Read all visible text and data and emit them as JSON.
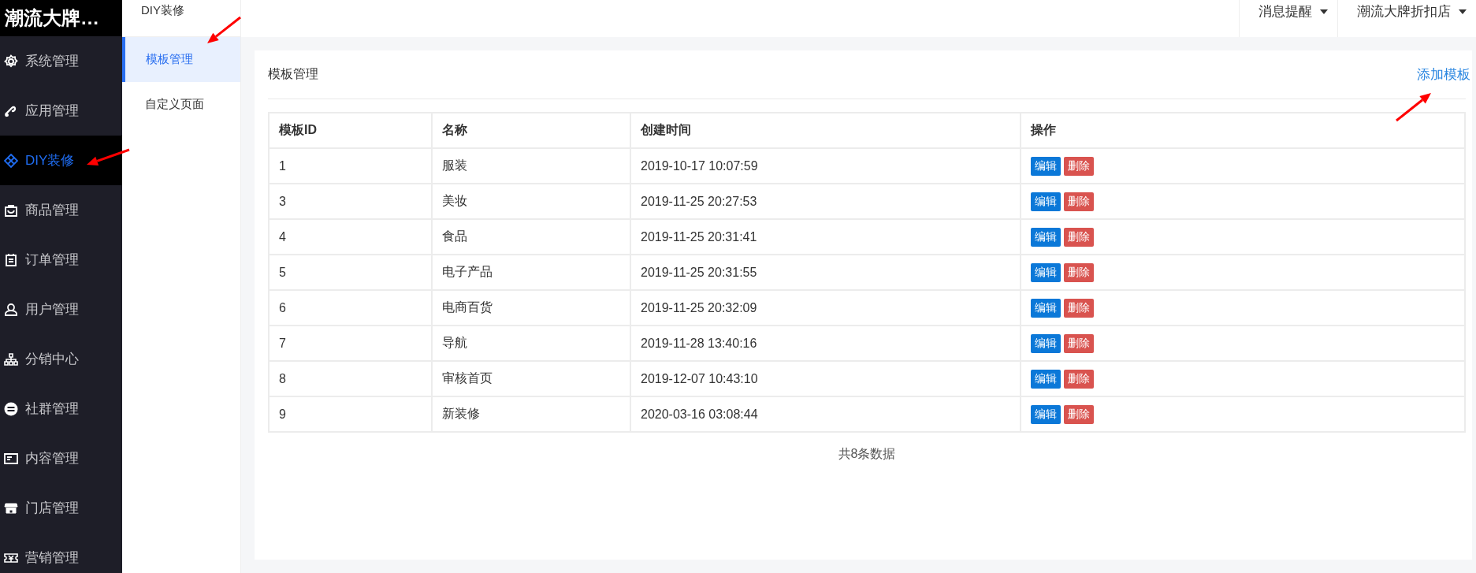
{
  "brand": "潮流大牌…",
  "sidebar": {
    "items": [
      {
        "label": "系统管理",
        "selected": false
      },
      {
        "label": "应用管理",
        "selected": false
      },
      {
        "label": "DIY装修",
        "selected": true
      },
      {
        "label": "商品管理",
        "selected": false
      },
      {
        "label": "订单管理",
        "selected": false
      },
      {
        "label": "用户管理",
        "selected": false
      },
      {
        "label": "分销中心",
        "selected": false
      },
      {
        "label": "社群管理",
        "selected": false
      },
      {
        "label": "内容管理",
        "selected": false
      },
      {
        "label": "门店管理",
        "selected": false
      },
      {
        "label": "营销管理",
        "selected": false
      }
    ]
  },
  "submenu": {
    "title": "DIY装修",
    "items": [
      {
        "label": "模板管理",
        "selected": true
      },
      {
        "label": "自定义页面",
        "selected": false
      }
    ]
  },
  "topbar": {
    "menus": [
      "消息提醒",
      "潮流大牌折扣店"
    ]
  },
  "card": {
    "title": "模板管理",
    "action": "添加模板"
  },
  "table": {
    "columns": [
      "模板ID",
      "名称",
      "创建时间",
      "操作"
    ],
    "rows": [
      {
        "id": "1",
        "name": "服装",
        "created": "2019-10-17 10:07:59",
        "actions": [
          "编辑",
          "删除"
        ]
      },
      {
        "id": "3",
        "name": "美妆",
        "created": "2019-11-25 20:27:53",
        "actions": [
          "编辑",
          "删除"
        ]
      },
      {
        "id": "4",
        "name": "食品",
        "created": "2019-11-25 20:31:41",
        "actions": [
          "编辑",
          "删除"
        ]
      },
      {
        "id": "5",
        "name": "电子产品",
        "created": "2019-11-25 20:31:55",
        "actions": [
          "编辑",
          "删除"
        ]
      },
      {
        "id": "6",
        "name": "电商百货",
        "created": "2019-11-25 20:32:09",
        "actions": [
          "编辑",
          "删除"
        ]
      },
      {
        "id": "7",
        "name": "导航",
        "created": "2019-11-28 13:40:16",
        "actions": [
          "编辑",
          "删除"
        ]
      },
      {
        "id": "8",
        "name": "审核首页",
        "created": "2019-12-07 10:43:10",
        "actions": [
          "编辑",
          "删除"
        ]
      },
      {
        "id": "9",
        "name": "新装修",
        "created": "2020-03-16 03:08:44",
        "actions": [
          "编辑",
          "删除"
        ]
      }
    ]
  },
  "footer": "共8条数据"
}
